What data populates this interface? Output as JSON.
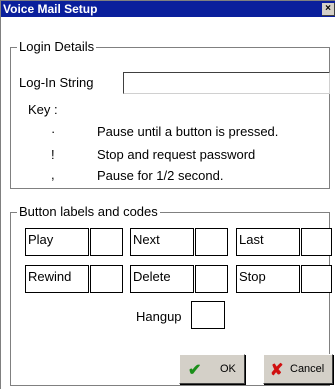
{
  "window": {
    "title": "Voice Mail Setup",
    "close_glyph": "×"
  },
  "login": {
    "legend": "Login Details",
    "label": "Log-In String",
    "value": "",
    "key_label": "Key :",
    "keys": [
      {
        "symbol": "·",
        "desc": "Pause until a button is pressed."
      },
      {
        "symbol": "!",
        "desc": "Stop and request password"
      },
      {
        "symbol": ",",
        "desc": "Pause for 1/2 second."
      }
    ]
  },
  "buttons_group": {
    "legend": "Button labels and codes",
    "row1": [
      "Play",
      "Next",
      "Last"
    ],
    "row2": [
      "Rewind",
      "Delete",
      "Stop"
    ],
    "hangup": "Hangup"
  },
  "actions": {
    "ok": "OK",
    "cancel": "Cancel",
    "ok_color": "#1a8f1a",
    "cancel_color": "#d01010"
  }
}
